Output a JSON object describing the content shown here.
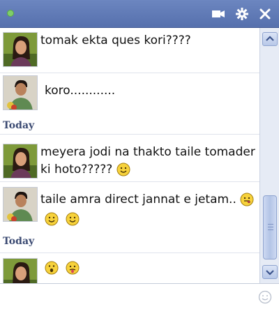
{
  "window": {
    "status": "online",
    "controls": [
      "video-call",
      "settings",
      "close"
    ]
  },
  "colors": {
    "titlebar": "#5d77b3",
    "online_dot": "#7fce6a",
    "today_label": "#3b4a72"
  },
  "messages": [
    {
      "sender": "female",
      "text": "tomak ekta ques kori????",
      "today": ""
    },
    {
      "sender": "male",
      "text": "koro............",
      "today": "Today"
    },
    {
      "sender": "female",
      "text": "meyera jodi na thakto taile tomader ki hoto?????",
      "today": "",
      "emoticons": [
        "smile"
      ]
    },
    {
      "sender": "male",
      "text": "taile amra direct jannat e jetam..",
      "today": "Today",
      "emoticons": [
        "tongue",
        "smile",
        "smile"
      ]
    },
    {
      "sender": "female",
      "text": "",
      "today": "",
      "emoticons": [
        "surprised",
        "tongue-sad"
      ]
    }
  ],
  "labels": {
    "today": "Today"
  },
  "composer": {
    "value": "",
    "placeholder": ""
  }
}
